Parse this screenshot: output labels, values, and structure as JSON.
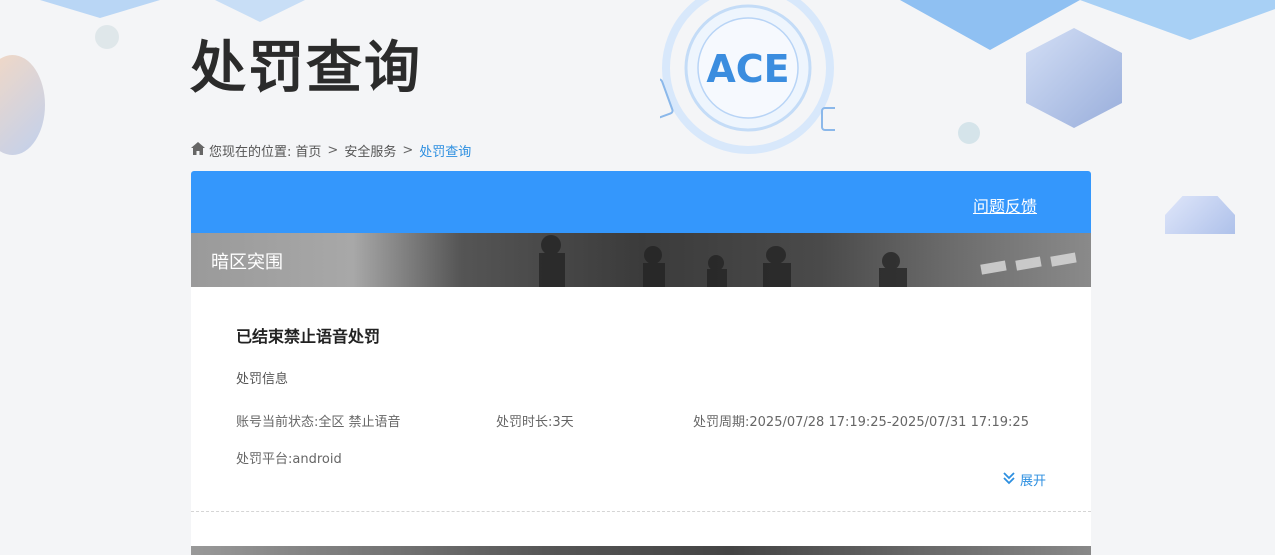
{
  "header": {
    "title": "处罚查询",
    "logo_text": "ACE"
  },
  "breadcrumb": {
    "prefix": "您现在的位置:",
    "items": [
      "首页",
      "安全服务"
    ],
    "current": "处罚查询",
    "separator": ">"
  },
  "panel": {
    "feedback_label": "问题反馈",
    "game_name": "暗区突围"
  },
  "card": {
    "title": "已结束禁止语音处罚",
    "info_title": "处罚信息",
    "status": "账号当前状态:全区 禁止语音",
    "duration": "处罚时长:3天",
    "period": "处罚周期:2025/07/28 17:19:25-2025/07/31 17:19:25",
    "platform": "处罚平台:android",
    "expand_label": "展开"
  },
  "colors": {
    "accent": "#3497fc",
    "link": "#2d8fe0",
    "background": "#f4f5f7"
  },
  "icons": {
    "breadcrumb": "home-icon",
    "expand": "double-chevron-down-icon"
  }
}
